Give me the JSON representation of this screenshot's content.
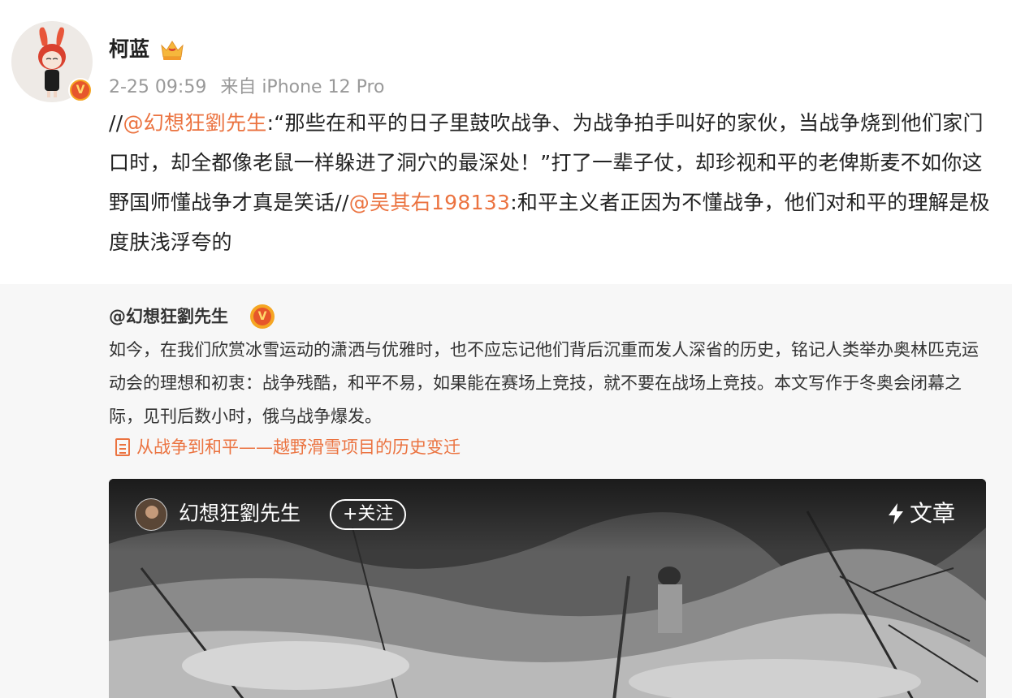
{
  "post": {
    "username": "柯蓝",
    "timestamp": "2-25 09:59",
    "source": "来自 iPhone 12 Pro",
    "text": {
      "prefix1": "//",
      "mention1": "@幻想狂劉先生",
      "part1": ":“那些在和平的日子里鼓吹战争、为战争拍手叫好的家伙，当战争烧到他们家门口时，却全都像老鼠一样躲进了洞穴的最深处！”打了一辈子仗，却珍视和平的老俾斯麦不如你这野国师懂战争才真是笑话//",
      "mention2": "@吴其右198133",
      "part2": ":和平主义者正因为不懂战争，他们对和平的理解是极度肤浅浮夸的"
    }
  },
  "repost": {
    "author": "@幻想狂劉先生",
    "text": "如今，在我们欣赏冰雪运动的潇洒与优雅时，也不应忘记他们背后沉重而发人深省的历史，铭记人类举办奥林匹克运动会的理想和初衷：战争残酷，和平不易，如果能在赛场上竞技，就不要在战场上竞技。本文写作于冬奥会闭幕之际，见刊后数小时，俄乌战争爆发。",
    "article_link": "从战争到和平——越野滑雪项目的历史变迁",
    "card": {
      "author": "幻想狂劉先生",
      "follow_label": "+关注",
      "type_label": "文章"
    }
  },
  "icons": {
    "verified": "verified-v-badge-icon",
    "crown": "vip-crown-icon",
    "document": "document-icon",
    "lightning": "lightning-icon"
  },
  "colors": {
    "mention": "#eb7340",
    "meta_text": "#999999",
    "repost_background": "#f7f7f7"
  }
}
